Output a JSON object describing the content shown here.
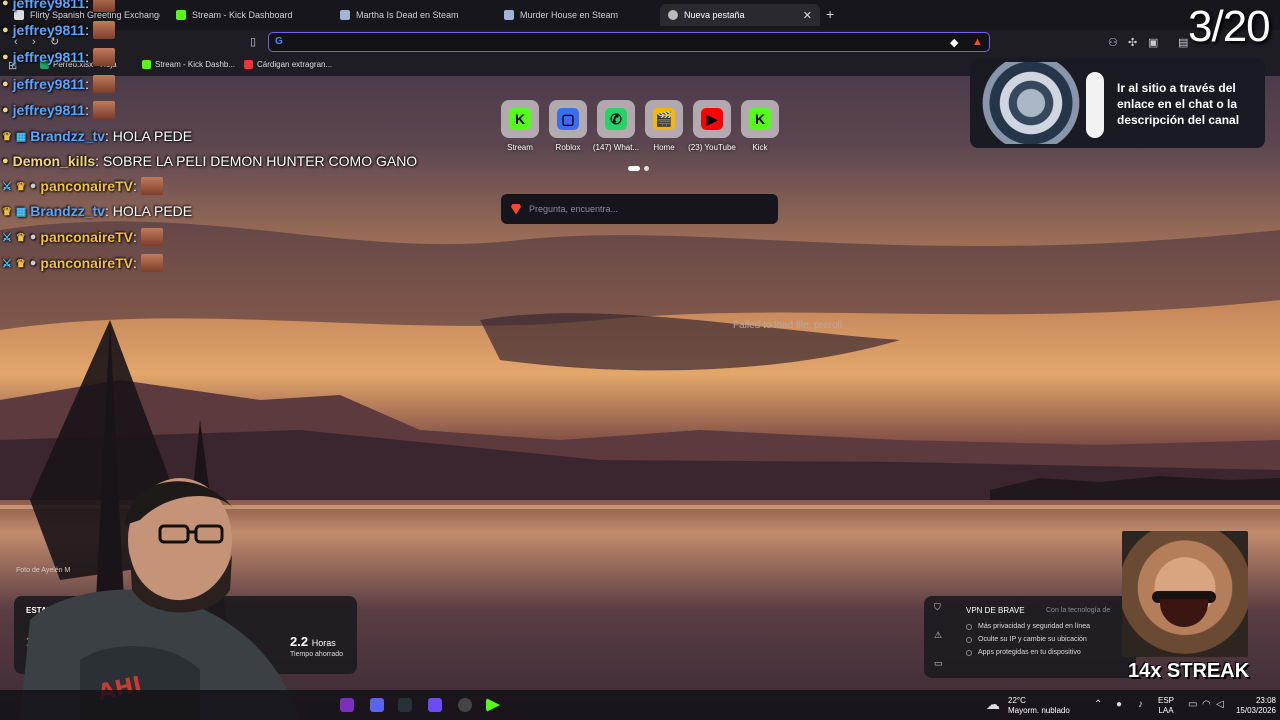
{
  "colors": {
    "accent": "#7463e4",
    "kick": "#53fc18",
    "brave": "#ef4b2c"
  },
  "tabs": [
    {
      "label": "Flirty Spanish Greeting Exchange - G",
      "icon": "openai-icon"
    },
    {
      "label": "Stream - Kick Dashboard",
      "icon": "kick-icon"
    },
    {
      "label": "Martha Is Dead en Steam",
      "icon": "steam-icon"
    },
    {
      "label": "Murder House en Steam",
      "icon": "steam-icon"
    },
    {
      "label": "Nueva pestaña",
      "icon": "brave-shield-icon",
      "active": true
    }
  ],
  "address": {
    "value": ""
  },
  "bookmarks": [
    {
      "label": "Perreo.xlsx - Hoja",
      "icon": "sheets-icon"
    },
    {
      "label": "Stream - Kick Dashb...",
      "icon": "kick-icon"
    },
    {
      "label": "Cárdigan extragran...",
      "icon": "store-icon"
    }
  ],
  "chat": [
    {
      "user": "jeffrey9811",
      "text": ":",
      "color": "#5aa7ff",
      "emote": true
    },
    {
      "user": "jeffrey9811",
      "text": ":",
      "color": "#5aa7ff",
      "emote": true
    },
    {
      "user": "jeffrey9811",
      "text": ":",
      "color": "#5aa7ff",
      "emote": true
    },
    {
      "user": "jeffrey9811",
      "text": ":",
      "color": "#5aa7ff",
      "emote": true
    },
    {
      "user": "jeffrey9811",
      "text": ":",
      "color": "#5aa7ff",
      "emote": true
    },
    {
      "user": "Brandzz_tv",
      "text": ": HOLA PEDE",
      "color": "#5aa7ff",
      "emote": false
    },
    {
      "user": "Demon_kills",
      "text": ": SOBRE LA PELI DEMON HUNTER COMO GANO",
      "color": "#f3d87a",
      "emote": false
    },
    {
      "user": "panconaireTV",
      "text": ":",
      "color": "#f3c13a",
      "emote": true
    },
    {
      "user": "Brandzz_tv",
      "text": ": HOLA PEDE",
      "color": "#5aa7ff",
      "emote": false
    },
    {
      "user": "panconaireTV",
      "text": ":",
      "color": "#f3c13a",
      "emote": true
    },
    {
      "user": "panconaireTV",
      "text": ":",
      "color": "#f3c13a",
      "emote": true
    }
  ],
  "shortcuts": [
    {
      "label": "Stream",
      "icon": "kick-icon",
      "color": "#53fc18",
      "glyph": "K"
    },
    {
      "label": "Roblox",
      "icon": "roblox-icon",
      "color": "#3b6df0",
      "glyph": "▢"
    },
    {
      "label": "(147) What...",
      "icon": "whatsapp-icon",
      "color": "#25d366",
      "glyph": "✆"
    },
    {
      "label": "Home",
      "icon": "clapperboard-icon",
      "color": "#f5b800",
      "glyph": "🎬"
    },
    {
      "label": "(23) YouTube",
      "icon": "youtube-icon",
      "color": "#ff0000",
      "glyph": "▶"
    },
    {
      "label": "Kick",
      "icon": "kick-icon",
      "color": "#53fc18",
      "glyph": "K"
    }
  ],
  "search": {
    "placeholder": "Pregunta, encuentra..."
  },
  "failed_text": "Failed to load file: preroll",
  "ad": {
    "text": "Ir al sitio a través del enlace en el chat o la descripción del canal"
  },
  "counter": "3/20",
  "photo_credit": "Foto de Ayelén M",
  "stats": {
    "title": "ESTADÍST",
    "value1": "15",
    "hours_value": "2.2",
    "hours_unit": "Horas",
    "hours_label": "Tiempo ahorrado"
  },
  "vpn": {
    "title": "VPN DE BRAVE",
    "subtitle": "Con la tecnología de",
    "items": [
      "Más privacidad y seguridad en línea",
      "Oculte su IP y cambie su ubicación",
      "Apps protegidas en tu dispositivo"
    ]
  },
  "streak": "14x STREAK",
  "taskbar": {
    "weather_temp": "22°C",
    "weather_desc": "Mayorm. nublado",
    "lang1": "ESP",
    "lang2": "LAA",
    "time": "23:08",
    "date": "15/03/2026"
  }
}
